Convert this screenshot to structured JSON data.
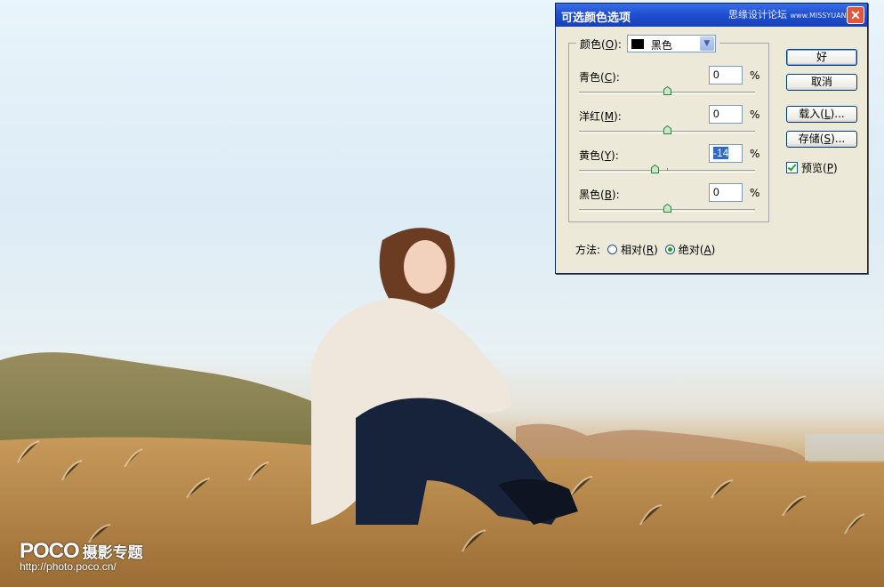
{
  "dialog": {
    "title": "可选颜色选项",
    "site_watermark": "思缘设计论坛",
    "site_watermark_small": "www.MISSYUAN.COM",
    "close_icon": "close-icon",
    "colors": {
      "field_label": "颜色(",
      "field_key": "O",
      "field_label_end": "):",
      "selected": "黑色",
      "swatch_color": "#000000"
    },
    "sliders": [
      {
        "label": "青色(",
        "key": "C",
        "label_end": "):",
        "value": "0",
        "unit": "%",
        "level": 0
      },
      {
        "label": "洋红(",
        "key": "M",
        "label_end": "):",
        "value": "0",
        "unit": "%",
        "level": 0
      },
      {
        "label": "黄色(",
        "key": "Y",
        "label_end": "):",
        "value": "-14",
        "unit": "%",
        "level": -14
      },
      {
        "label": "黑色(",
        "key": "B",
        "label_end": "):",
        "value": "0",
        "unit": "%",
        "level": 0
      }
    ],
    "buttons": {
      "ok": "好",
      "cancel": "取消",
      "load_label": "载入(",
      "load_key": "L",
      "load_end": ")...",
      "save_label": "存储(",
      "save_key": "S",
      "save_end": ")..."
    },
    "preview": {
      "label": "预览(",
      "key": "P",
      "label_end": ")",
      "checked": true
    },
    "method": {
      "label": "方法:",
      "relative_label": "相对(",
      "relative_key": "R",
      "relative_end": ")",
      "absolute_label": "绝对(",
      "absolute_key": "A",
      "absolute_end": ")",
      "selected": "absolute"
    },
    "titlebar_color": "#1f4fd2",
    "face_color": "#ece9d8"
  },
  "watermark": {
    "logo": "POCO",
    "brand": "摄影专题",
    "url": "http://photo.poco.cn/"
  }
}
